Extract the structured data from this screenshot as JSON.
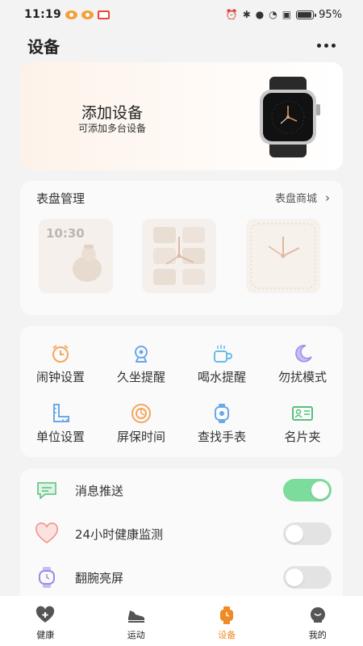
{
  "status_bar": {
    "time": "11:19",
    "battery": "95%",
    "battery_level": 0.95
  },
  "header": {
    "title": "设备"
  },
  "add_device": {
    "title": "添加设备",
    "subtitle": "可添加多台设备"
  },
  "dial_section": {
    "title": "表盘管理",
    "store_label": "表盘商城",
    "dials": [
      {
        "time": "10:30"
      },
      {},
      {}
    ]
  },
  "functions": [
    {
      "label": "闹钟设置",
      "icon": "alarm-clock-icon",
      "color": "#f3a65a"
    },
    {
      "label": "久坐提醒",
      "icon": "sitting-chair-icon",
      "color": "#6aa8e8"
    },
    {
      "label": "喝水提醒",
      "icon": "water-cup-icon",
      "color": "#65bde8"
    },
    {
      "label": "勿扰模式",
      "icon": "moon-icon",
      "color": "#9c8ce8"
    },
    {
      "label": "单位设置",
      "icon": "ruler-icon",
      "color": "#6aa8e8"
    },
    {
      "label": "屏保时间",
      "icon": "screen-saver-icon",
      "color": "#f3a65a"
    },
    {
      "label": "查找手表",
      "icon": "watch-search-icon",
      "color": "#6aa8e8"
    },
    {
      "label": "名片夹",
      "icon": "business-card-icon",
      "color": "#56c07e"
    }
  ],
  "settings": [
    {
      "label": "消息推送",
      "icon": "message-icon",
      "enabled": true
    },
    {
      "label": "24小时健康监测",
      "icon": "heart-icon",
      "enabled": false
    },
    {
      "label": "翻腕亮屏",
      "icon": "wrist-watch-icon",
      "enabled": false
    }
  ],
  "tabs": [
    {
      "label": "健康",
      "icon": "health-icon",
      "active": false
    },
    {
      "label": "运动",
      "icon": "sneaker-icon",
      "active": false
    },
    {
      "label": "设备",
      "icon": "watch-icon",
      "active": true
    },
    {
      "label": "我的",
      "icon": "profile-icon",
      "active": false
    }
  ],
  "colors": {
    "accent": "#f08a24",
    "toggle_on": "#7bdc9b",
    "background": "#f3f3f3"
  }
}
